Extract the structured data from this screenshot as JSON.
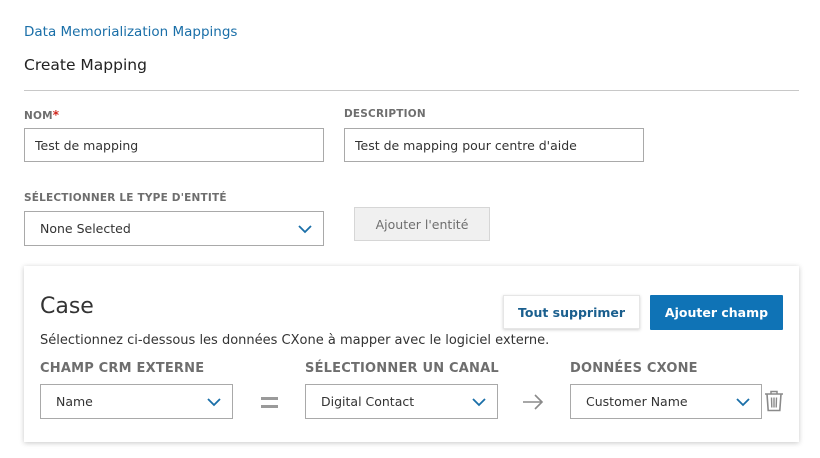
{
  "breadcrumb": "Data Memorialization Mappings",
  "page_title": "Create Mapping",
  "form": {
    "name_label": "NOM",
    "required_marker": "*",
    "name_value": "Test de mapping",
    "description_label": "DESCRIPTION",
    "description_value": "Test de mapping pour centre d'aide",
    "entity_type_label": "SÉLECTIONNER LE TYPE D'ENTITÉ",
    "entity_type_value": "None Selected",
    "add_entity_label": "Ajouter l'entité"
  },
  "card": {
    "title": "Case",
    "description": "Sélectionnez ci-dessous les données CXone à mapper avec le logiciel externe.",
    "delete_all_label": "Tout supprimer",
    "add_field_label": "Ajouter champ",
    "columns": {
      "crm_field": "CHAMP CRM EXTERNE",
      "channel": "SÉLECTIONNER UN CANAL",
      "cxone_data": "DONNÉES CXONE"
    },
    "row": {
      "crm_field_value": "Name",
      "channel_value": "Digital Contact",
      "cxone_data_value": "Customer Name"
    }
  },
  "icons": {
    "chevron": "chevron-down-icon",
    "equals": "equals-icon",
    "arrow": "arrow-right-icon",
    "trash": "trash-icon"
  },
  "colors": {
    "link": "#1a6fa8",
    "primary": "#0f73b6",
    "secondary_text": "#1a5f8e",
    "required": "#d0271d",
    "label": "#6e6e6e",
    "chevron": "#1a6fa8"
  }
}
